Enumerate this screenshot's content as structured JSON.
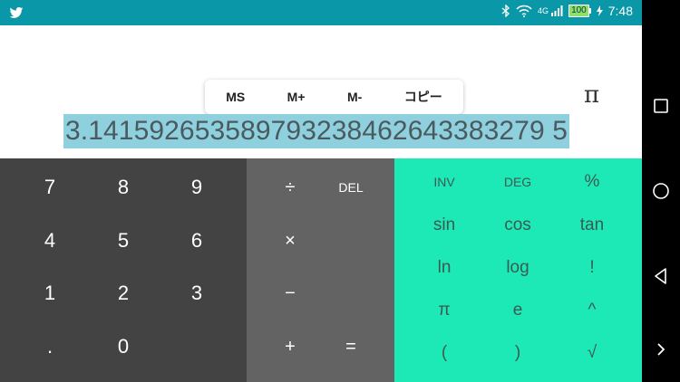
{
  "status_bar": {
    "app_icon": "twitter-icon",
    "network": "4G",
    "battery": "100",
    "time": "7:48",
    "color": "#0a97a7"
  },
  "display": {
    "context_menu": [
      "MS",
      "M+",
      "M-",
      "コピー"
    ],
    "result": "3.141592653589793238462643383279 5",
    "symbol": "π"
  },
  "keypad": {
    "numbers": [
      "7",
      "8",
      "9",
      "4",
      "5",
      "6",
      "1",
      "2",
      "3",
      ".",
      "0"
    ],
    "operators": [
      "÷",
      "DEL",
      "×",
      "−",
      "+",
      "="
    ],
    "advanced": [
      "INV",
      "DEG",
      "%",
      "sin",
      "cos",
      "tan",
      "ln",
      "log",
      "!",
      "π",
      "e",
      "^",
      "(",
      ")",
      "√"
    ]
  },
  "colors": {
    "numpad": "#434343",
    "ops": "#636363",
    "advanced": "#1de9b6",
    "selection": "#8fd0df"
  },
  "navigation": [
    "square-icon",
    "circle-icon",
    "back-triangle-icon",
    "chevron-right-icon"
  ]
}
